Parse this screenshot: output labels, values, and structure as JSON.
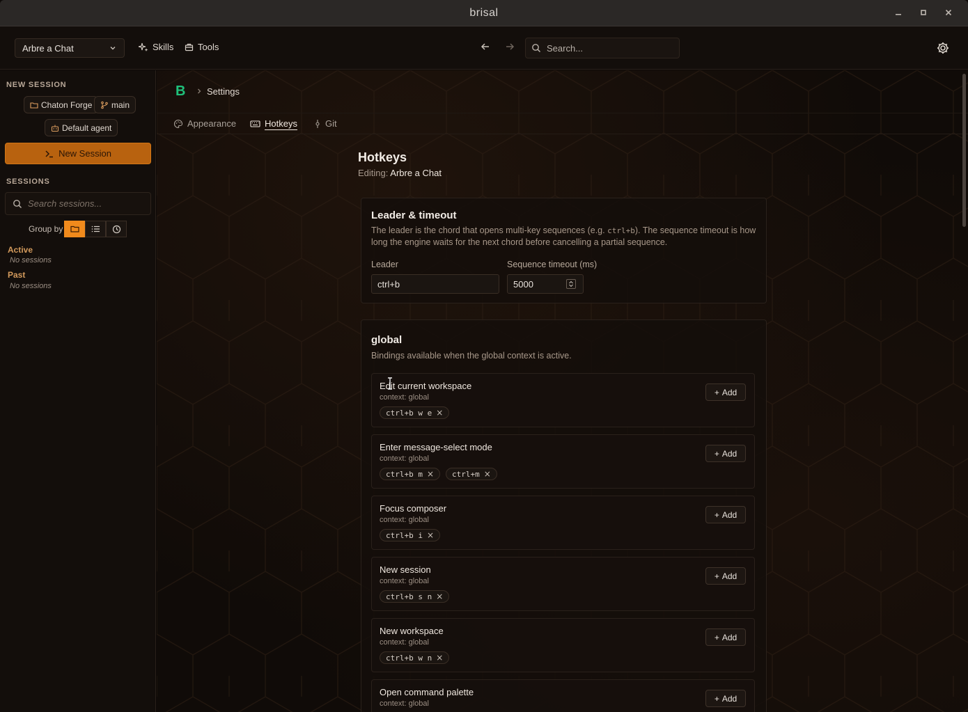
{
  "window": {
    "title": "brisal",
    "controls": [
      "minimize-icon",
      "maximize-icon",
      "close-icon"
    ]
  },
  "appbar": {
    "workspace": "Arbre a Chat",
    "skills_label": "Skills",
    "tools_label": "Tools",
    "search_placeholder": "Search..."
  },
  "sidebar": {
    "new_session_heading": "NEW SESSION",
    "project_chip": "Chaton Forge",
    "branch_chip": "main",
    "agent_chip": "Default agent",
    "new_session_button": "New Session",
    "sessions_heading": "SESSIONS",
    "search_placeholder": "Search sessions...",
    "group_by_label": "Group by",
    "groups": [
      {
        "title": "Active",
        "empty": "No sessions"
      },
      {
        "title": "Past",
        "empty": "No sessions"
      }
    ]
  },
  "breadcrumb": {
    "logo": "B",
    "current": "Settings"
  },
  "tabs": [
    {
      "label": "Appearance",
      "active": false
    },
    {
      "label": "Hotkeys",
      "active": true
    },
    {
      "label": "Git",
      "active": false
    }
  ],
  "page": {
    "title": "Hotkeys",
    "editing_label": "Editing:",
    "editing_value": "Arbre a Chat"
  },
  "leader_panel": {
    "title": "Leader & timeout",
    "desc_part1": "The leader is the chord that opens multi-key sequences (e.g. ",
    "desc_code": "ctrl+b",
    "desc_part2": "). The sequence timeout is how long the engine waits for the next chord before cancelling a partial sequence.",
    "leader_label": "Leader",
    "leader_value": "ctrl+b",
    "timeout_label": "Sequence timeout (ms)",
    "timeout_value": "5000"
  },
  "global_panel": {
    "title": "global",
    "desc": "Bindings available when the global context is active.",
    "add_label": "Add",
    "bindings": [
      {
        "title": "Edit current workspace",
        "context": "context: global",
        "keys": [
          "ctrl+b w e"
        ]
      },
      {
        "title": "Enter message-select mode",
        "context": "context: global",
        "keys": [
          "ctrl+b m",
          "ctrl+m"
        ]
      },
      {
        "title": "Focus composer",
        "context": "context: global",
        "keys": [
          "ctrl+b i"
        ]
      },
      {
        "title": "New session",
        "context": "context: global",
        "keys": [
          "ctrl+b s n"
        ]
      },
      {
        "title": "New workspace",
        "context": "context: global",
        "keys": [
          "ctrl+b w n"
        ]
      },
      {
        "title": "Open command palette",
        "context": "context: global",
        "keys": []
      }
    ]
  },
  "colors": {
    "accent": "#f08a1c",
    "primary_button": "#b8620f",
    "logo": "#1fbf7a"
  }
}
